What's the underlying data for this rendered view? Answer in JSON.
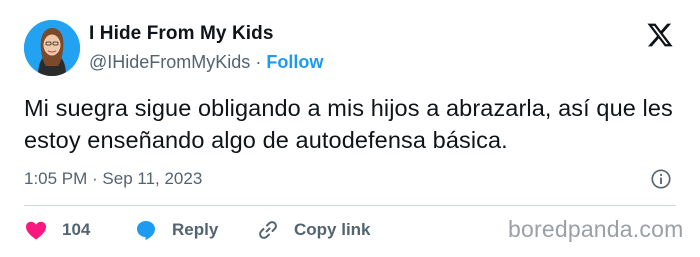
{
  "author": {
    "name": "I Hide From My Kids",
    "handle": "@IHideFromMyKids",
    "separator": "·",
    "follow_label": "Follow"
  },
  "tweet": {
    "text": "Mi suegra sigue obligando a mis hijos a abrazarla, así que les estoy enseñando algo de autodefensa básica.",
    "timestamp": "1:05 PM · Sep 11, 2023"
  },
  "actions": {
    "like_count": "104",
    "reply_label": "Reply",
    "copy_link_label": "Copy link"
  },
  "watermark": "boredpanda.com",
  "colors": {
    "accent": "#1d9bf0",
    "like": "#f91880",
    "secondary_text": "#536471",
    "primary_text": "#0f1419"
  },
  "icons": [
    "x-logo-icon",
    "info-icon",
    "heart-icon",
    "reply-bubble-icon",
    "link-icon"
  ]
}
